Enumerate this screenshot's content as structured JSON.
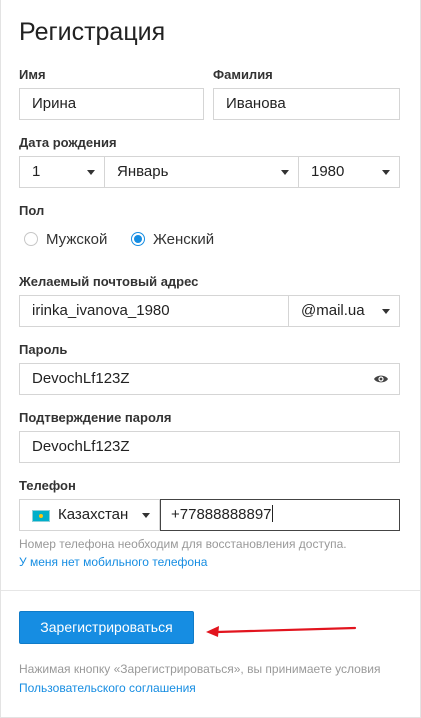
{
  "form": {
    "title": "Регистрация",
    "first_name": {
      "label": "Имя",
      "value": "Ирина"
    },
    "last_name": {
      "label": "Фамилия",
      "value": "Иванова"
    },
    "birth": {
      "label": "Дата рождения",
      "day": "1",
      "month": "Январь",
      "year": "1980"
    },
    "gender": {
      "label": "Пол",
      "options": [
        "Мужской",
        "Женский"
      ],
      "selected": "Женский"
    },
    "email": {
      "label": "Желаемый почтовый адрес",
      "value": "irinka_ivanova_1980",
      "domain": "@mail.ua"
    },
    "password": {
      "label": "Пароль",
      "value": "DevochLf123Z"
    },
    "password_confirm": {
      "label": "Подтверждение пароля",
      "value": "DevochLf123Z"
    },
    "phone": {
      "label": "Телефон",
      "country": "Казахстан",
      "value": "+77888888897",
      "hint": "Номер телефона необходим для восстановления доступа.",
      "no_phone_link": "У меня нет мобильного телефона"
    },
    "submit_label": "Зарегистрироваться",
    "agreement_text": "Нажимая кнопку «Зарегистрироваться», вы принимаете условия",
    "agreement_link": "Пользовательского соглашения"
  },
  "colors": {
    "accent": "#168de2",
    "arrow": "#e2141e"
  },
  "icons": {
    "password_toggle": "eye-icon",
    "country_flag": "kazakhstan-flag-icon",
    "annotation": "red-arrow-icon"
  }
}
